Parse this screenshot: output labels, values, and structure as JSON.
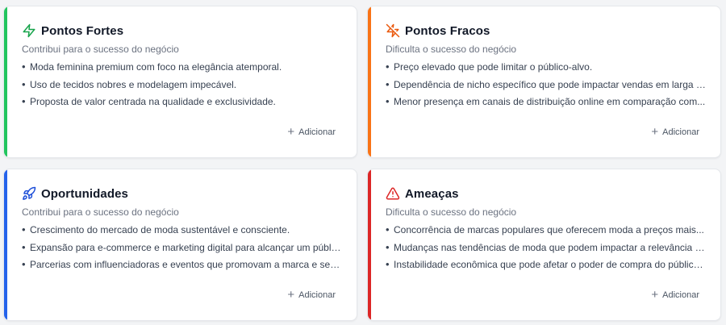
{
  "colors": {
    "strengths": "#22c55e",
    "weaknesses": "#f97316",
    "opportunities": "#2563eb",
    "threats": "#dc2626"
  },
  "cards": [
    {
      "key": "strengths",
      "title": "Pontos Fortes",
      "icon": "zap-icon",
      "subtitle": "Contribui para o sucesso do negócio",
      "items": [
        "Moda feminina premium com foco na elegância atemporal.",
        "Uso de tecidos nobres e modelagem impecável.",
        "Proposta de valor centrada na qualidade e exclusividade."
      ],
      "add_label": "Adicionar"
    },
    {
      "key": "weaknesses",
      "title": "Pontos Fracos",
      "icon": "zap-off-icon",
      "subtitle": "Dificulta o sucesso do negócio",
      "items": [
        "Preço elevado que pode limitar o público-alvo.",
        "Dependência de nicho específico que pode impactar vendas em larga escala.",
        "Menor presença em canais de distribuição online em comparação com..."
      ],
      "add_label": "Adicionar"
    },
    {
      "key": "opportunities",
      "title": "Oportunidades",
      "icon": "rocket-icon",
      "subtitle": "Contribui para o sucesso do negócio",
      "items": [
        "Crescimento do mercado de moda sustentável e consciente.",
        "Expansão para e-commerce e marketing digital para alcançar um público ma...",
        "Parcerias com influenciadoras e eventos que promovam a marca e seus..."
      ],
      "add_label": "Adicionar"
    },
    {
      "key": "threats",
      "title": "Ameaças",
      "icon": "warning-triangle-icon",
      "subtitle": "Dificulta o sucesso do negócio",
      "items": [
        "Concorrência de marcas populares que oferecem moda a preços mais...",
        "Mudanças nas tendências de moda que podem impactar a relevância da...",
        "Instabilidade econômica que pode afetar o poder de compra do público-alvo."
      ],
      "add_label": "Adicionar"
    }
  ]
}
